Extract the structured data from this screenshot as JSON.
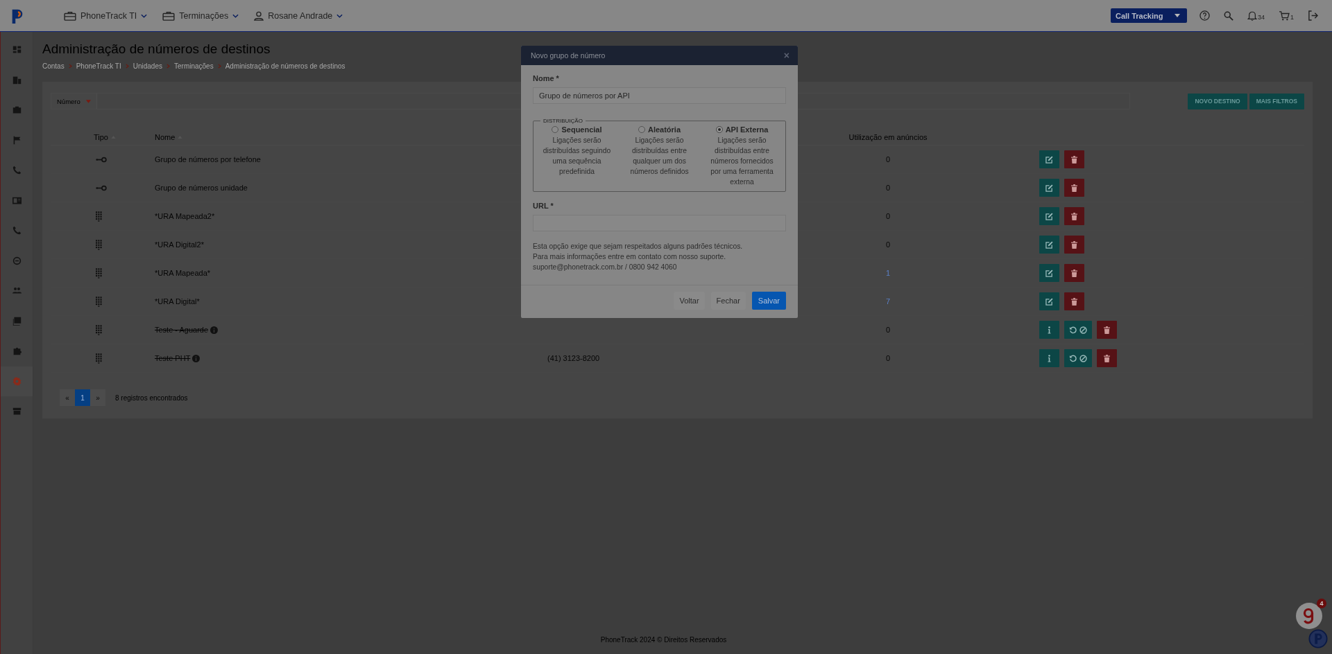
{
  "topbar": {
    "menus": [
      {
        "label": "PhoneTrack TI"
      },
      {
        "label": "Terminações"
      },
      {
        "label": "Rosane Andrade"
      }
    ],
    "product_select": "Call Tracking",
    "notifications": "34",
    "cart": "1"
  },
  "sidebar": {
    "items": [
      {
        "selected": false
      },
      {
        "selected": false
      },
      {
        "selected": false
      },
      {
        "selected": false
      },
      {
        "selected": false
      },
      {
        "selected": false
      },
      {
        "selected": false
      },
      {
        "selected": false
      },
      {
        "selected": false
      },
      {
        "selected": false
      },
      {
        "selected": false
      },
      {
        "selected": true
      },
      {
        "selected": false
      }
    ]
  },
  "page": {
    "title": "Administração de números de destinos",
    "breadcrumb": [
      "Contas",
      "PhoneTrack TI",
      "Unidades",
      "Terminações",
      "Administração de números de destinos"
    ]
  },
  "filter": {
    "field": "Número",
    "buttons": [
      "NOVO DESTINO",
      "MAIS FILTROS"
    ]
  },
  "table": {
    "columns": [
      "Tipo",
      "Nome",
      "Utilização em anúncios"
    ],
    "rows": [
      {
        "kind": "group",
        "name": "Grupo de números por telefone",
        "usage": "0",
        "link": false,
        "removed": false
      },
      {
        "kind": "group",
        "name": "Grupo de números unidade",
        "usage": "0",
        "link": false,
        "removed": false
      },
      {
        "kind": "ura",
        "name": "*URA Mapeada2*",
        "usage": "0",
        "link": false,
        "removed": false
      },
      {
        "kind": "ura",
        "name": "*URA Digital2*",
        "usage": "0",
        "link": false,
        "removed": false
      },
      {
        "kind": "ura",
        "name": "*URA Mapeada*",
        "usage": "1",
        "link": true,
        "removed": false
      },
      {
        "kind": "ura",
        "name": "*URA Digital*",
        "usage": "7",
        "link": true,
        "removed": false
      },
      {
        "kind": "ura",
        "name": "Teste - Aguarde",
        "usage": "0",
        "link": false,
        "removed": true
      },
      {
        "kind": "ura",
        "name": "Teste PHT",
        "column_3": "(41) 3123-8200",
        "usage": "0",
        "link": false,
        "removed": true
      }
    ]
  },
  "pagination": {
    "prev": "«",
    "pages": [
      {
        "label": "1",
        "selected": true
      }
    ],
    "next": "»",
    "count": "8 registros encontrados"
  },
  "footer": "PhoneTrack 2024 © Direitos Reservados",
  "widget": {
    "badge": "4"
  },
  "modal": {
    "title": "Novo grupo de número",
    "close": "×",
    "name_label": "Nome *",
    "name_value": "Grupo de números por API",
    "legend": "DISTRIBUIÇÃO",
    "options": [
      {
        "label": "Sequencial",
        "description": "Ligações serão distribuídas seguindo uma sequência predefinida",
        "selected": false
      },
      {
        "label": "Aleatória",
        "description": "Ligações serão distribuídas entre qualquer um dos números definidos",
        "selected": false
      },
      {
        "label": "API Externa",
        "description": "Ligações serão distribuídas entre números fornecidos por uma ferramenta externa",
        "selected": true
      }
    ],
    "url_label": "URL *",
    "help": [
      "Esta opção exige que sejam respeitados alguns padrões técnicos.",
      "Para mais informações entre em contato com nosso suporte.",
      "suporte@phonetrack.com.br / 0800 942 4060"
    ],
    "buttons": [
      {
        "label": "Voltar",
        "kind": "secondary"
      },
      {
        "label": "Fechar",
        "kind": "secondary"
      },
      {
        "label": "Salvar",
        "kind": "primary"
      }
    ]
  }
}
